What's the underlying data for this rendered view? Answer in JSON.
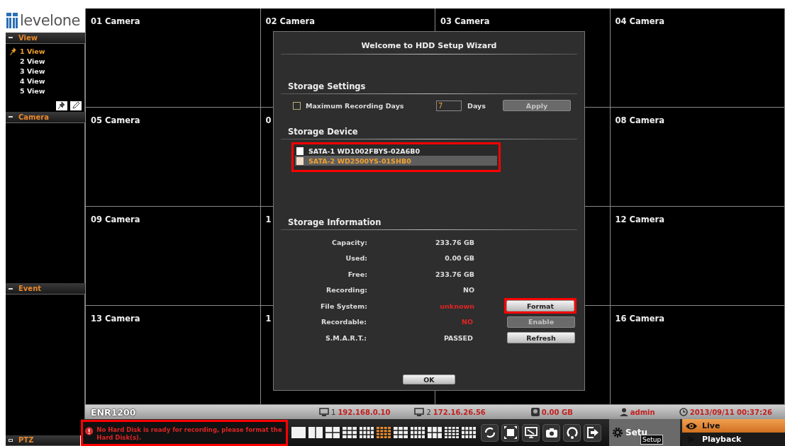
{
  "logo": {
    "text": "levelone"
  },
  "sidebar": {
    "sections": [
      {
        "title": "View",
        "expanded": true,
        "items": [
          {
            "label": "1 View",
            "selected": true
          },
          {
            "label": "2 View",
            "selected": false
          },
          {
            "label": "3 View",
            "selected": false
          },
          {
            "label": "4 View",
            "selected": false
          },
          {
            "label": "5 View",
            "selected": false
          }
        ]
      },
      {
        "title": "Camera",
        "expanded": true
      },
      {
        "title": "Event",
        "expanded": true
      },
      {
        "title": "PTZ",
        "expanded": false
      }
    ]
  },
  "cameras": [
    {
      "label": "01 Camera"
    },
    {
      "label": "02 Camera"
    },
    {
      "label": "03 Camera"
    },
    {
      "label": "04 Camera"
    },
    {
      "label": "05 Camera"
    },
    {
      "label": "0"
    },
    {
      "label": "08 Camera"
    },
    {
      "label": "09 Camera"
    },
    {
      "label": "1"
    },
    {
      "label": "12 Camera"
    },
    {
      "label": "13 Camera"
    },
    {
      "label": "1"
    },
    {
      "label": "16 Camera"
    }
  ],
  "dialog": {
    "title": "Welcome to  HDD Setup Wizard",
    "storage_settings": {
      "heading": "Storage Settings",
      "max_days": {
        "label": "Maximum Recording Days",
        "checked": false
      },
      "days_value": "7",
      "days_unit": "Days",
      "apply": {
        "label": "Apply",
        "disabled": true
      }
    },
    "storage_device": {
      "heading": "Storage Device",
      "devices": [
        {
          "label": "SATA-1 WD1002FBYS-02A6B0",
          "selected": false
        },
        {
          "label": "SATA-2 WD2500YS-01SHB0",
          "selected": true
        }
      ]
    },
    "storage_information": {
      "heading": "Storage Information",
      "rows": [
        {
          "label": "Capacity:",
          "value": "233.76 GB",
          "alert": false
        },
        {
          "label": "Used:",
          "value": "0.00 GB",
          "alert": false
        },
        {
          "label": "Free:",
          "value": "233.76 GB",
          "alert": false
        },
        {
          "label": "Recording:",
          "value": "NO",
          "alert": false
        },
        {
          "label": "File System:",
          "value": "unknown",
          "alert": true,
          "button": {
            "label": "Format",
            "disabled": false,
            "highlighted": true
          }
        },
        {
          "label": "Recordable:",
          "value": "NO",
          "alert": true,
          "button": {
            "label": "Enable",
            "disabled": true,
            "highlighted": false
          }
        },
        {
          "label": "S.M.A.R.T.:",
          "value": "PASSED",
          "alert": false,
          "button": {
            "label": "Refresh",
            "disabled": false,
            "highlighted": false
          }
        }
      ]
    },
    "ok": "OK"
  },
  "status_bar": {
    "model": "ENR1200",
    "items": [
      {
        "kind": "monitor",
        "index": "1",
        "value": "192.168.0.10"
      },
      {
        "kind": "monitor",
        "index": "2",
        "value": "172.16.26.56"
      },
      {
        "kind": "disk",
        "value": "0.00 GB"
      },
      {
        "kind": "user",
        "value": "admin"
      },
      {
        "kind": "clock",
        "value": "2013/09/11 00:37:26"
      }
    ]
  },
  "error_message": "No Hard Disk is ready for recording, please format the Hard Disk(s).",
  "layout_buttons": [
    {
      "selected": false
    },
    {
      "selected": false
    },
    {
      "selected": false
    },
    {
      "selected": false
    },
    {
      "selected": false
    },
    {
      "selected": true
    },
    {
      "selected": false
    },
    {
      "selected": false
    },
    {
      "selected": false
    },
    {
      "selected": false
    },
    {
      "selected": false
    }
  ],
  "setup": {
    "label": "Setu",
    "tooltip": "Setup"
  },
  "modes": [
    {
      "label": "Live",
      "selected": true
    },
    {
      "label": "Playback",
      "selected": false
    }
  ]
}
